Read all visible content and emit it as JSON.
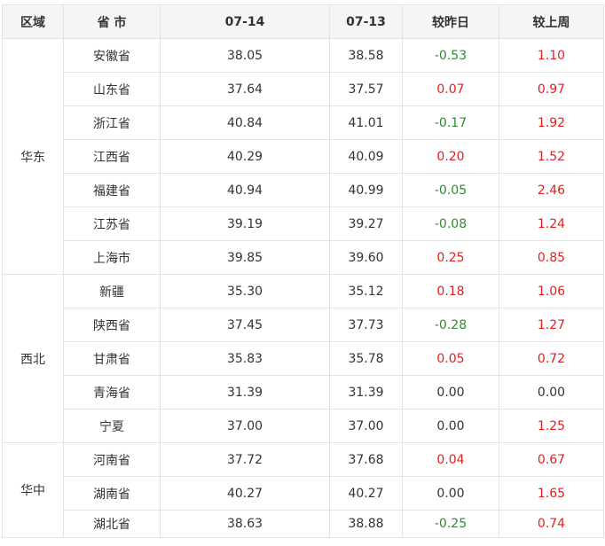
{
  "headers": {
    "region": "区域",
    "province": "省 市",
    "date1": "07-14",
    "date2": "07-13",
    "vs_yesterday": "较昨日",
    "vs_last_week": "较上周"
  },
  "colors": {
    "positive": "#e02020",
    "negative": "#2e8b2e",
    "neutral": "#333333"
  },
  "groups": [
    {
      "region": "华东",
      "rows": [
        {
          "province": "安徽省",
          "d1": "38.05",
          "d2": "38.58",
          "day": "-0.53",
          "week": "1.10"
        },
        {
          "province": "山东省",
          "d1": "37.64",
          "d2": "37.57",
          "day": "0.07",
          "week": "0.97"
        },
        {
          "province": "浙江省",
          "d1": "40.84",
          "d2": "41.01",
          "day": "-0.17",
          "week": "1.92"
        },
        {
          "province": "江西省",
          "d1": "40.29",
          "d2": "40.09",
          "day": "0.20",
          "week": "1.52"
        },
        {
          "province": "福建省",
          "d1": "40.94",
          "d2": "40.99",
          "day": "-0.05",
          "week": "2.46"
        },
        {
          "province": "江苏省",
          "d1": "39.19",
          "d2": "39.27",
          "day": "-0.08",
          "week": "1.24"
        },
        {
          "province": "上海市",
          "d1": "39.85",
          "d2": "39.60",
          "day": "0.25",
          "week": "0.85"
        }
      ]
    },
    {
      "region": "西北",
      "rows": [
        {
          "province": "新疆",
          "d1": "35.30",
          "d2": "35.12",
          "day": "0.18",
          "week": "1.06"
        },
        {
          "province": "陕西省",
          "d1": "37.45",
          "d2": "37.73",
          "day": "-0.28",
          "week": "1.27"
        },
        {
          "province": "甘肃省",
          "d1": "35.83",
          "d2": "35.78",
          "day": "0.05",
          "week": "0.72"
        },
        {
          "province": "青海省",
          "d1": "31.39",
          "d2": "31.39",
          "day": "0.00",
          "week": "0.00"
        },
        {
          "province": "宁夏",
          "d1": "37.00",
          "d2": "37.00",
          "day": "0.00",
          "week": "1.25"
        }
      ]
    },
    {
      "region": "华中",
      "rows": [
        {
          "province": "河南省",
          "d1": "37.72",
          "d2": "37.68",
          "day": "0.04",
          "week": "0.67"
        },
        {
          "province": "湖南省",
          "d1": "40.27",
          "d2": "40.27",
          "day": "0.00",
          "week": "1.65"
        },
        {
          "province": "湖北省",
          "d1": "38.63",
          "d2": "38.88",
          "day": "-0.25",
          "week": "0.74"
        }
      ]
    }
  ]
}
